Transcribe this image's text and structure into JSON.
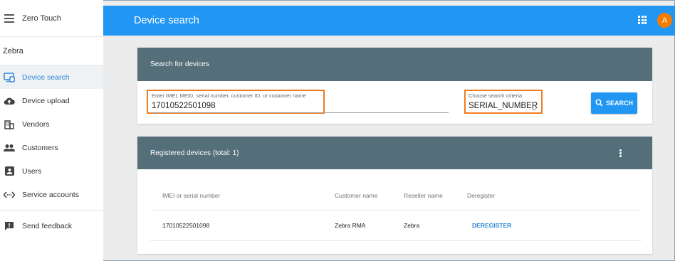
{
  "sidebar": {
    "app_name": "Zero Touch",
    "org_name": "Zebra",
    "items": [
      {
        "label": "Device search",
        "icon": "device-search-icon"
      },
      {
        "label": "Device upload",
        "icon": "cloud-upload-icon"
      },
      {
        "label": "Vendors",
        "icon": "vendors-icon"
      },
      {
        "label": "Customers",
        "icon": "customers-icon"
      },
      {
        "label": "Users",
        "icon": "users-icon"
      },
      {
        "label": "Service accounts",
        "icon": "service-accounts-icon"
      }
    ],
    "feedback_label": "Send feedback"
  },
  "header": {
    "title": "Device search",
    "avatar_letter": "A",
    "avatar_color": "#f57c00",
    "accent": "#2196f3"
  },
  "search": {
    "card_title": "Search for devices",
    "query_label": "Enter IMEI, MEID, serial number, customer ID, or customer name",
    "query_value": "17010522501098",
    "criteria_label": "Choose search criteria",
    "criteria_value": "SERIAL_NUMBER",
    "button_label": "SEARCH"
  },
  "devices": {
    "card_title": "Registered devices (total: 1)",
    "columns": [
      "IMEI or serial number",
      "Customer name",
      "Reseller name",
      "Deregister"
    ],
    "rows": [
      {
        "serial": "17010522501098",
        "customer": "Zebra RMA",
        "reseller": "Zebra",
        "action": "DEREGISTER"
      }
    ]
  }
}
